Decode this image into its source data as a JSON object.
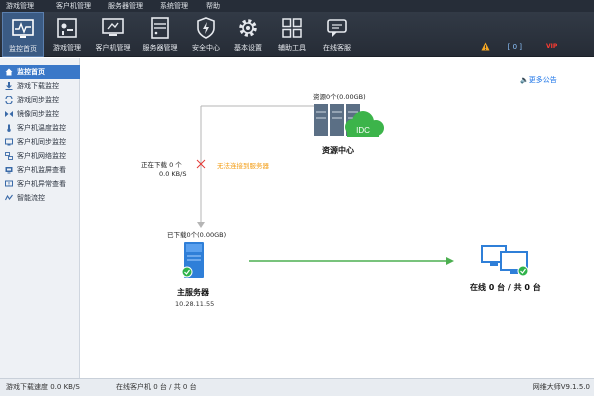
{
  "menu": [
    "游戏管理",
    "客户机管理",
    "服务器管理",
    "系统管理",
    "帮助"
  ],
  "toolbar": {
    "items": [
      {
        "label": "监控首页",
        "icon": "monitor-pulse-icon"
      },
      {
        "label": "游戏管理",
        "icon": "gamepad-icon"
      },
      {
        "label": "客户机管理",
        "icon": "client-pc-icon"
      },
      {
        "label": "服务器管理",
        "icon": "server-icon"
      },
      {
        "label": "安全中心",
        "icon": "shield-bolt-icon"
      },
      {
        "label": "基本设置",
        "icon": "gear-icon"
      },
      {
        "label": "辅助工具",
        "icon": "tools-grid-icon"
      },
      {
        "label": "在线客服",
        "icon": "chat-icon"
      }
    ],
    "status_text": "[ 0 ]",
    "vip": "VIP"
  },
  "sidebar": {
    "items": [
      {
        "label": "监控首页",
        "icon": "home-icon"
      },
      {
        "label": "游戏下载监控",
        "icon": "download-icon"
      },
      {
        "label": "游戏同步监控",
        "icon": "sync-icon"
      },
      {
        "label": "镜像同步监控",
        "icon": "mirror-icon"
      },
      {
        "label": "客户机温度监控",
        "icon": "thermometer-icon"
      },
      {
        "label": "客户机同步监控",
        "icon": "client-sync-icon"
      },
      {
        "label": "客户机网络监控",
        "icon": "network-icon"
      },
      {
        "label": "客户机监屏查看",
        "icon": "screen-icon"
      },
      {
        "label": "客户机异常查看",
        "icon": "alert-monitor-icon"
      },
      {
        "label": "智能流控",
        "icon": "flow-control-icon"
      }
    ]
  },
  "main": {
    "notice_link": "更多公告",
    "resource_label": "资源0个(0.00GB)",
    "resource_title": "资源中心",
    "idc_text": "IDC",
    "downloading": "正在下载 0 个",
    "speed": "0.0 KB/S",
    "connection_warning": "无法连接到服务器",
    "downloaded": "已下载0个(0.00GB)",
    "server_title": "主服务器",
    "server_ip": "10.28.11.55",
    "online_count": "在线 0 台 / 共 0 台"
  },
  "statusbar": {
    "game_speed": "游戏下载速度 0.0 KB/S",
    "online_clients": "在线客户机 0 台 / 共 0 台",
    "version": "网维大师V9.1.5.0"
  },
  "colors": {
    "accent_blue": "#3a78c8",
    "toolbar_bg": "#2b323d",
    "line_green": "#4caf50",
    "warning_orange": "#f39c12",
    "idc_green": "#3cb44a"
  }
}
